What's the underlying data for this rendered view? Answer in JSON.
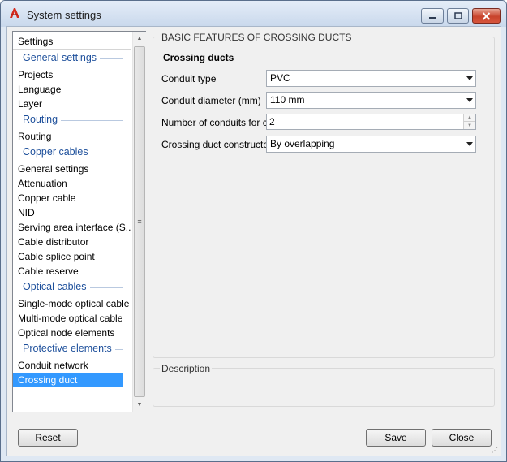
{
  "window": {
    "title": "System settings"
  },
  "tree": {
    "header": "Settings",
    "groups": [
      {
        "title": "General settings",
        "items": [
          "Projects",
          "Language",
          "Layer"
        ]
      },
      {
        "title": "Routing",
        "items": [
          "Routing"
        ]
      },
      {
        "title": "Copper cables",
        "items": [
          "General settings",
          "Attenuation",
          "Copper cable",
          "NID",
          "Serving area interface (S...",
          "Cable distributor",
          "Cable splice point",
          "Cable reserve"
        ]
      },
      {
        "title": "Optical cables",
        "items": [
          "Single-mode optical cable",
          "Multi-mode optical cable",
          "Optical node elements"
        ]
      },
      {
        "title": "Protective elements",
        "items": [
          "Conduit network",
          "Crossing duct"
        ]
      }
    ],
    "selected": "Crossing duct"
  },
  "features": {
    "group_title": "BASIC FEATURES OF CROSSING DUCTS",
    "section_title": "Crossing ducts",
    "conduit_type": {
      "label": "Conduit type",
      "value": "PVC"
    },
    "conduit_diameter": {
      "label": "Conduit diameter (mm)",
      "value": "110 mm"
    },
    "num_conduits": {
      "label": "Number of conduits for crossing",
      "value": "2"
    },
    "constructed_by": {
      "label": "Crossing duct constructed by",
      "value": "By overlapping"
    }
  },
  "description": {
    "title": "Description"
  },
  "buttons": {
    "reset": "Reset",
    "save": "Save",
    "close": "Close"
  },
  "colors": {
    "selection": "#3399ff",
    "group_heading": "#1d4f9b",
    "close_button": "#c8432c"
  }
}
